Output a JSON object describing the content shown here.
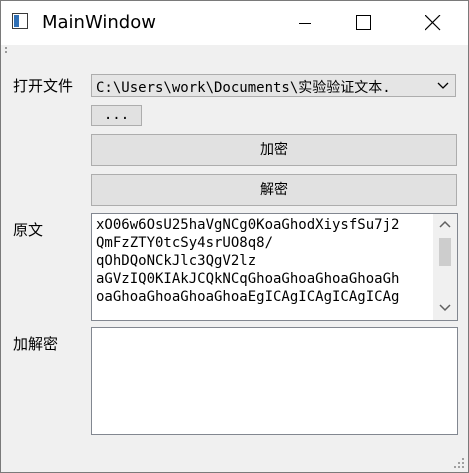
{
  "window": {
    "title": "MainWindow"
  },
  "form": {
    "open_file_label": "打开文件",
    "file_path": "C:\\Users\\work\\Documents\\实验验证文本.",
    "browse_label": "...",
    "encrypt_label": "加密",
    "decrypt_label": "解密",
    "original_label": "原文",
    "original_text": "xO06w6OsU25haVgNCg0KoaGhodXiysfSu7j2\nQmFzZTY0tcSy4srUO8q8/\nqOhDQoNCkJlc3QgV2lz\naGVzIQ0KIAkJCQkNCqGhoaGhoaGhoaGhoaGh\noaGhoaGhoaGhoaGhoaEgICAgICAgICAgICAg",
    "crypt_label": "加解密",
    "crypt_text": ""
  },
  "icons": {
    "app": "app-window-icon",
    "minimize": "minimize-icon",
    "maximize": "maximize-icon",
    "close": "close-icon",
    "dropdown": "chevron-down-icon",
    "scroll_up": "scroll-up-arrow-icon",
    "scroll_down": "scroll-down-arrow-icon"
  }
}
